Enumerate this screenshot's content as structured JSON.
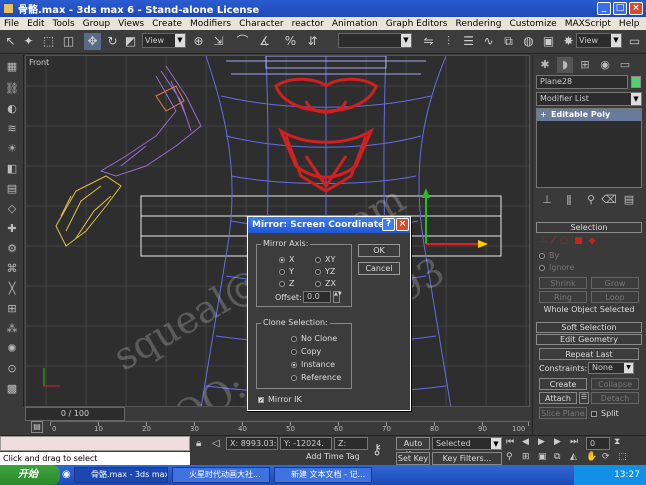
{
  "window": {
    "title": "骨骼.max - 3ds max 6 - Stand-alone License"
  },
  "menu": [
    "File",
    "Edit",
    "Tools",
    "Group",
    "Views",
    "Create",
    "Modifiers",
    "Character",
    "reactor",
    "Animation",
    "Graph Editors",
    "Rendering",
    "Customize",
    "MAXScript",
    "Help"
  ],
  "toolbar": {
    "refcoord": "View",
    "viewdrop": "View"
  },
  "viewport": {
    "label": "Front"
  },
  "panel": {
    "object_name": "Plane28",
    "modifier_list": "Modifier List",
    "stack_item": "Editable Poly",
    "selection": "Selection",
    "by_vertex": "By",
    "ignore": "Ignore",
    "shrink": "Shrink",
    "grow": "Grow",
    "ring": "Ring",
    "loop": "Loop",
    "status": "Whole Object Selected",
    "soft_selection": "Soft Selection",
    "edit_geometry": "Edit Geometry",
    "repeat_last": "Repeat Last",
    "constraints_label": "Constraints:",
    "constraints_value": "None",
    "create": "Create",
    "collapse": "Collapse",
    "attach": "Attach",
    "detach": "Detach",
    "slice_plane": "Slice Plane",
    "split": "Split"
  },
  "timeline": {
    "slider": "0 / 100",
    "ticks": [
      "0",
      "10",
      "20",
      "30",
      "40",
      "50",
      "60",
      "70",
      "80",
      "90",
      "100"
    ]
  },
  "status": {
    "x": "X: 8993.03:",
    "y": "Y: -12024.",
    "z": "Z: -10841.",
    "prompt": "Click and drag to select",
    "add_time_tag": "Add Time Tag",
    "auto_key": "Auto Key",
    "set_key": "Set Key",
    "key_filters": "Key Filters...",
    "selected": "Selected",
    "frame": "0"
  },
  "dialog": {
    "title": "Mirror: Screen Coordinates",
    "mirror_axis": "Mirror Axis:",
    "axes": [
      "X",
      "Y",
      "Z",
      "XY",
      "YZ",
      "ZX"
    ],
    "offset_label": "Offset:",
    "offset_value": "0.0",
    "ok": "OK",
    "cancel": "Cancel",
    "clone_selection": "Clone Selection:",
    "clone_options": [
      "No Clone",
      "Copy",
      "Instance",
      "Reference"
    ],
    "mirror_ik": "Mirror IK"
  },
  "taskbar": {
    "start": "开始",
    "tasks": [
      "骨骼.max - 3ds max ...",
      "火星时代动画大社...",
      "新建 文本文档 - 记..."
    ],
    "clock": "13:27"
  },
  "watermark": {
    "line1": "squeal@163.com",
    "line2": "QQ: 115416493"
  }
}
